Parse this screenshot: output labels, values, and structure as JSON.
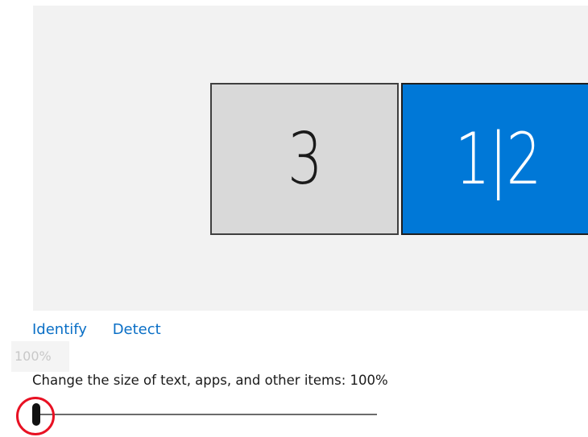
{
  "display_arrangement": {
    "monitors": [
      {
        "id": "monitor-3",
        "label": "3",
        "selected": false
      },
      {
        "id": "monitor-12",
        "label": "1|2",
        "selected": true
      }
    ],
    "colors": {
      "background": "#f2f2f2",
      "selected_monitor": "#0078d7",
      "unselected_monitor": "#d9d9d9"
    }
  },
  "links": {
    "identify_label": "Identify",
    "detect_label": "Detect",
    "link_color": "#0a6fc6"
  },
  "scale": {
    "tooltip_value": "100%",
    "label": "Change the size of text, apps, and other items: 100%",
    "slider_fraction": 0.0
  },
  "annotation": {
    "highlight_color": "#e81123",
    "highlight_icon": "red-circle-highlight"
  }
}
